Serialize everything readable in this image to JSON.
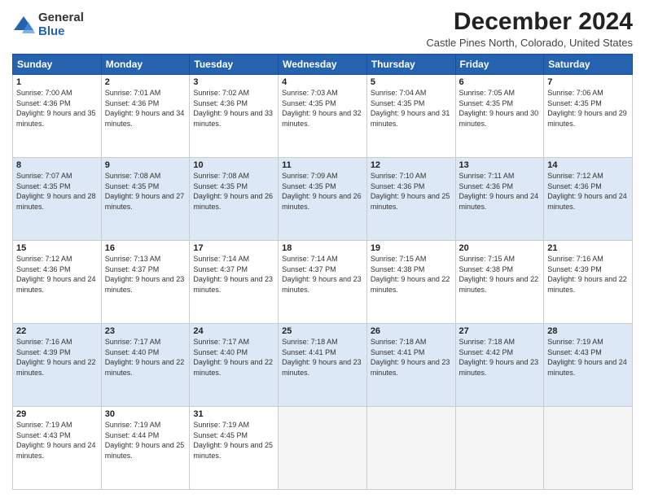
{
  "logo": {
    "general": "General",
    "blue": "Blue"
  },
  "title": "December 2024",
  "location": "Castle Pines North, Colorado, United States",
  "days_header": [
    "Sunday",
    "Monday",
    "Tuesday",
    "Wednesday",
    "Thursday",
    "Friday",
    "Saturday"
  ],
  "weeks": [
    [
      {
        "day": "1",
        "rise": "7:00 AM",
        "set": "4:36 PM",
        "daylight": "9 hours and 35 minutes."
      },
      {
        "day": "2",
        "rise": "7:01 AM",
        "set": "4:36 PM",
        "daylight": "9 hours and 34 minutes."
      },
      {
        "day": "3",
        "rise": "7:02 AM",
        "set": "4:36 PM",
        "daylight": "9 hours and 33 minutes."
      },
      {
        "day": "4",
        "rise": "7:03 AM",
        "set": "4:35 PM",
        "daylight": "9 hours and 32 minutes."
      },
      {
        "day": "5",
        "rise": "7:04 AM",
        "set": "4:35 PM",
        "daylight": "9 hours and 31 minutes."
      },
      {
        "day": "6",
        "rise": "7:05 AM",
        "set": "4:35 PM",
        "daylight": "9 hours and 30 minutes."
      },
      {
        "day": "7",
        "rise": "7:06 AM",
        "set": "4:35 PM",
        "daylight": "9 hours and 29 minutes."
      }
    ],
    [
      {
        "day": "8",
        "rise": "7:07 AM",
        "set": "4:35 PM",
        "daylight": "9 hours and 28 minutes."
      },
      {
        "day": "9",
        "rise": "7:08 AM",
        "set": "4:35 PM",
        "daylight": "9 hours and 27 minutes."
      },
      {
        "day": "10",
        "rise": "7:08 AM",
        "set": "4:35 PM",
        "daylight": "9 hours and 26 minutes."
      },
      {
        "day": "11",
        "rise": "7:09 AM",
        "set": "4:35 PM",
        "daylight": "9 hours and 26 minutes."
      },
      {
        "day": "12",
        "rise": "7:10 AM",
        "set": "4:36 PM",
        "daylight": "9 hours and 25 minutes."
      },
      {
        "day": "13",
        "rise": "7:11 AM",
        "set": "4:36 PM",
        "daylight": "9 hours and 24 minutes."
      },
      {
        "day": "14",
        "rise": "7:12 AM",
        "set": "4:36 PM",
        "daylight": "9 hours and 24 minutes."
      }
    ],
    [
      {
        "day": "15",
        "rise": "7:12 AM",
        "set": "4:36 PM",
        "daylight": "9 hours and 24 minutes."
      },
      {
        "day": "16",
        "rise": "7:13 AM",
        "set": "4:37 PM",
        "daylight": "9 hours and 23 minutes."
      },
      {
        "day": "17",
        "rise": "7:14 AM",
        "set": "4:37 PM",
        "daylight": "9 hours and 23 minutes."
      },
      {
        "day": "18",
        "rise": "7:14 AM",
        "set": "4:37 PM",
        "daylight": "9 hours and 23 minutes."
      },
      {
        "day": "19",
        "rise": "7:15 AM",
        "set": "4:38 PM",
        "daylight": "9 hours and 22 minutes."
      },
      {
        "day": "20",
        "rise": "7:15 AM",
        "set": "4:38 PM",
        "daylight": "9 hours and 22 minutes."
      },
      {
        "day": "21",
        "rise": "7:16 AM",
        "set": "4:39 PM",
        "daylight": "9 hours and 22 minutes."
      }
    ],
    [
      {
        "day": "22",
        "rise": "7:16 AM",
        "set": "4:39 PM",
        "daylight": "9 hours and 22 minutes."
      },
      {
        "day": "23",
        "rise": "7:17 AM",
        "set": "4:40 PM",
        "daylight": "9 hours and 22 minutes."
      },
      {
        "day": "24",
        "rise": "7:17 AM",
        "set": "4:40 PM",
        "daylight": "9 hours and 22 minutes."
      },
      {
        "day": "25",
        "rise": "7:18 AM",
        "set": "4:41 PM",
        "daylight": "9 hours and 23 minutes."
      },
      {
        "day": "26",
        "rise": "7:18 AM",
        "set": "4:41 PM",
        "daylight": "9 hours and 23 minutes."
      },
      {
        "day": "27",
        "rise": "7:18 AM",
        "set": "4:42 PM",
        "daylight": "9 hours and 23 minutes."
      },
      {
        "day": "28",
        "rise": "7:19 AM",
        "set": "4:43 PM",
        "daylight": "9 hours and 24 minutes."
      }
    ],
    [
      {
        "day": "29",
        "rise": "7:19 AM",
        "set": "4:43 PM",
        "daylight": "9 hours and 24 minutes."
      },
      {
        "day": "30",
        "rise": "7:19 AM",
        "set": "4:44 PM",
        "daylight": "9 hours and 25 minutes."
      },
      {
        "day": "31",
        "rise": "7:19 AM",
        "set": "4:45 PM",
        "daylight": "9 hours and 25 minutes."
      },
      null,
      null,
      null,
      null
    ]
  ],
  "labels": {
    "sunrise": "Sunrise:",
    "sunset": "Sunset:",
    "daylight": "Daylight:"
  }
}
